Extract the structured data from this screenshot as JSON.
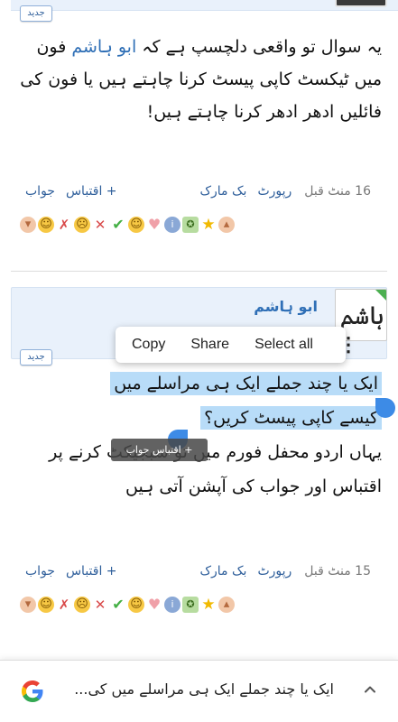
{
  "post1": {
    "badge": "جدید",
    "body_before_link": "یہ سوال تو واقعی دلچسپ ہے کہ ",
    "author_link": "ابو ہاشم",
    "body_after_link": " فون میں ٹیکسٹ کاپی پیسٹ کرنا چاہتے ہیں یا فون کی فائلیں ادھر ادھر کرنا چاہتے ہیں!",
    "meta": {
      "time": "16 منٹ قبل",
      "report": "رپورٹ",
      "bookmark": "بک مارک",
      "quote": "+ اقتباس",
      "reply": "جواب"
    }
  },
  "post2": {
    "badge": "جدید",
    "author": "ابو ہاشم",
    "avatar_text": "ہاشم",
    "selected_line1": "ایک یا چند جملے ایک ہی مراسلے میں",
    "selected_line2": "کیسے کاپی پیسٹ کریں؟",
    "body_rest": "یہاں اردو محفل فورم میں تو سبجیکٹ کرنے پر اقتباس اور جواب کی آپشن آتی ہیں",
    "meta": {
      "time": "15 منٹ قبل",
      "report": "رپورٹ",
      "bookmark": "بک مارک",
      "quote": "+ اقتباس",
      "reply": "جواب"
    }
  },
  "context_menu": {
    "copy": "Copy",
    "share": "Share",
    "select_all": "Select all"
  },
  "tooltip": "+ اقتباس جواب",
  "bottom_bar": {
    "query_text": "ایک یا چند جملے ایک ہی مراسلے میں کی...",
    "logo_icon": "google-g-icon",
    "chevron_icon": "chevron-up-icon"
  },
  "reactions": [
    "thumbs-down-icon",
    "laugh-icon",
    "no-icon",
    "disagree-icon",
    "sad-icon",
    "check-icon",
    "smile-icon",
    "heart-icon",
    "info-icon",
    "winner-icon",
    "star-icon",
    "thumbs-up-icon"
  ],
  "colors": {
    "link": "#2f6fb6",
    "selection": "#b8dcf8",
    "handle": "#3d8be6",
    "header_bg": "#e9f1fb"
  }
}
